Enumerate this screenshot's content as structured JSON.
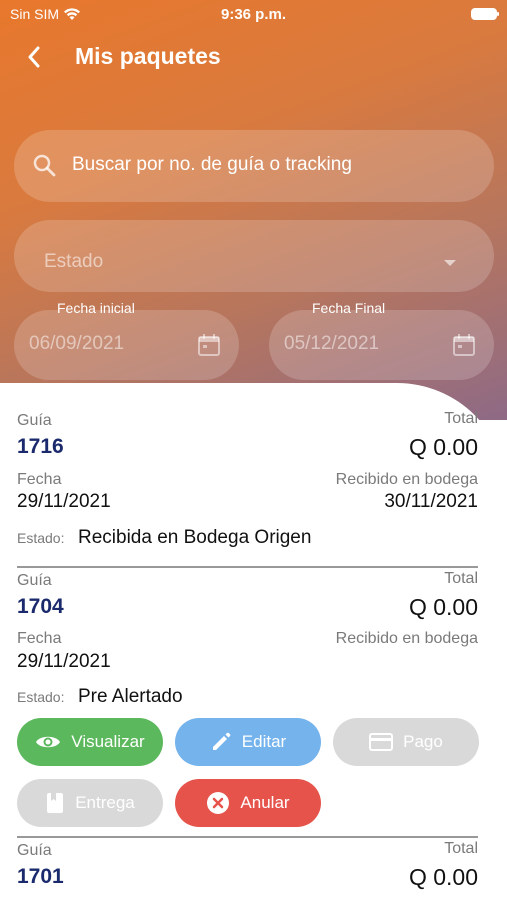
{
  "status_bar": {
    "carrier": "Sin SIM",
    "time": "9:36 p.m."
  },
  "header": {
    "title": "Mis paquetes"
  },
  "filters": {
    "search_placeholder": "Buscar por no. de guía o tracking",
    "estado_placeholder": "Estado",
    "fecha_inicial_label": "Fecha inicial",
    "fecha_inicial_value": "06/09/2021",
    "fecha_final_label": "Fecha Final",
    "fecha_final_value": "05/12/2021"
  },
  "packages": [
    {
      "guia_label": "Guía",
      "guia": "1716",
      "total_label": "Total",
      "total": "Q 0.00",
      "fecha_label": "Fecha",
      "fecha": "29/11/2021",
      "recibido_label": "Recibido en bodega",
      "recibido": "30/11/2021",
      "estado_label": "Estado:",
      "estado": "Recibida en Bodega Origen"
    },
    {
      "guia_label": "Guía",
      "guia": "1704",
      "total_label": "Total",
      "total": "Q 0.00",
      "fecha_label": "Fecha",
      "fecha": "29/11/2021",
      "recibido_label": "Recibido en bodega",
      "recibido": "",
      "estado_label": "Estado:",
      "estado": "Pre Alertado",
      "actions": {
        "visualizar": "Visualizar",
        "editar": "Editar",
        "pago": "Pago",
        "entrega": "Entrega",
        "anular": "Anular"
      }
    },
    {
      "guia_label": "Guía",
      "guia": "1701",
      "total_label": "Total",
      "total": "Q 0.00"
    }
  ],
  "colors": {
    "header_gradient_start": "#e8782c",
    "header_gradient_end": "#8e6a86",
    "guia_number": "#1a2a6c",
    "btn_green": "#5cb85c",
    "btn_blue": "#74b3ec",
    "btn_grey": "#d9d9d9",
    "btn_red": "#e5534b"
  },
  "icons": [
    "wifi-icon",
    "battery-icon",
    "back-arrow-icon",
    "search-icon",
    "dropdown-caret-icon",
    "calendar-icon",
    "eye-icon",
    "pencil-icon",
    "card-icon",
    "book-icon",
    "close-circle-icon"
  ]
}
